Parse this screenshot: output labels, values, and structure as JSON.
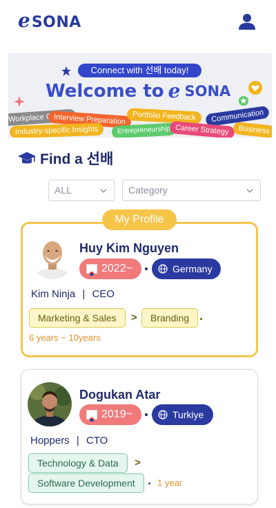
{
  "header": {
    "logo_mark": "e",
    "logo_word": "SONA",
    "profile_icon": "user-icon"
  },
  "banner": {
    "connect_text": "Connect with 선배 today!",
    "welcome_text": "Welcome to",
    "welcome_logo_mark": "e",
    "welcome_logo_word": "SONA",
    "tags": [
      "Workplace Culture",
      "Interview Preparation",
      "Portfolio Feedback",
      "Communication",
      "Industry-specific Insights",
      "Entrepreneurship",
      "Career Strategy",
      "Business"
    ],
    "colors": {
      "blue": "#3b4ec8",
      "orange": "#f2662e",
      "yellow": "#f2b41f",
      "pink": "#e84a78",
      "green": "#5ec96d",
      "grey": "#8b8b8b",
      "navy": "#2b3aa0"
    }
  },
  "find": {
    "icon": "graduation-cap-icon",
    "title": "Find a 선배",
    "filter_year": {
      "value": "ALL"
    },
    "filter_category": {
      "placeholder": "Category"
    }
  },
  "my_profile_label": "My Profile",
  "profiles": [
    {
      "name": "Huy Kim Nguyen",
      "year": "2022~",
      "country": "Germany",
      "company": "Kim Ninja",
      "role": "CEO",
      "tags": [
        "Marketing & Sales",
        "Branding"
      ],
      "arrow": ">",
      "experience": "6 years ~ 10years"
    },
    {
      "name": "Dogukan Atar",
      "year": "2019~",
      "country": "Turkiye",
      "company": "Hoppers",
      "role": "CTO",
      "tags": [
        "Technology & Data",
        "Software Development"
      ],
      "arrow": ">",
      "experience": "1 year"
    }
  ]
}
